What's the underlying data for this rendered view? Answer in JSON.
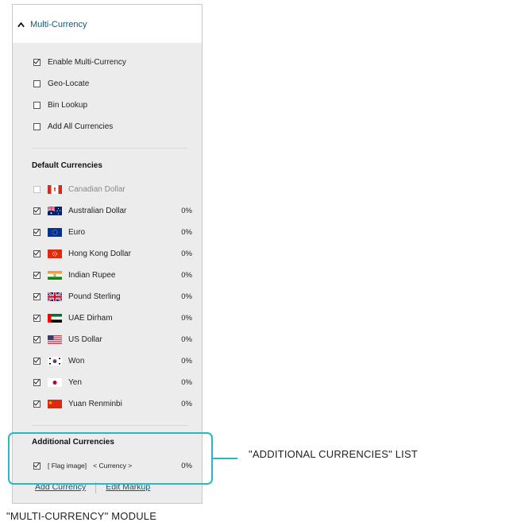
{
  "panel": {
    "title": "Multi-Currency",
    "options": [
      {
        "label": "Enable Multi-Currency",
        "checked": true
      },
      {
        "label": "Geo-Locate",
        "checked": false
      },
      {
        "label": "Bin Lookup",
        "checked": false
      },
      {
        "label": "Add All Currencies",
        "checked": false
      }
    ],
    "default_title": "Default Currencies",
    "default_currencies": [
      {
        "name": "Canadian Dollar",
        "pct": "",
        "checked": false,
        "disabled": true,
        "flag": "canada-flag-icon"
      },
      {
        "name": "Australian Dollar",
        "pct": "0%",
        "checked": true,
        "flag": "australia-flag-icon"
      },
      {
        "name": "Euro",
        "pct": "0%",
        "checked": true,
        "flag": "eu-flag-icon"
      },
      {
        "name": "Hong Kong Dollar",
        "pct": "0%",
        "checked": true,
        "flag": "hong-kong-flag-icon"
      },
      {
        "name": "Indian Rupee",
        "pct": "0%",
        "checked": true,
        "flag": "india-flag-icon"
      },
      {
        "name": "Pound Sterling",
        "pct": "0%",
        "checked": true,
        "flag": "uk-flag-icon"
      },
      {
        "name": "UAE Dirham",
        "pct": "0%",
        "checked": true,
        "flag": "uae-flag-icon"
      },
      {
        "name": "US Dollar",
        "pct": "0%",
        "checked": true,
        "flag": "us-flag-icon"
      },
      {
        "name": "Won",
        "pct": "0%",
        "checked": true,
        "flag": "korea-flag-icon"
      },
      {
        "name": "Yen",
        "pct": "0%",
        "checked": true,
        "flag": "japan-flag-icon"
      },
      {
        "name": "Yuan Renminbi",
        "pct": "0%",
        "checked": true,
        "flag": "china-flag-icon"
      }
    ],
    "additional_title": "Additional Currencies",
    "additional_row": {
      "flag_text": "[ Flag  image]",
      "currency_text": "< Currency >",
      "pct": "0%",
      "checked": true
    },
    "add_currency_label": "Add Currency",
    "edit_markup_label": "Edit Markup"
  },
  "annotations": {
    "callout": "\"ADDITIONAL CURRENCIES\" LIST",
    "caption": "\"MULTI-CURRENCY\" MODULE",
    "highlight_color": "#2ab7c2"
  },
  "colors": {
    "accent": "#0e5a74",
    "panel_bg": "#ececec"
  }
}
